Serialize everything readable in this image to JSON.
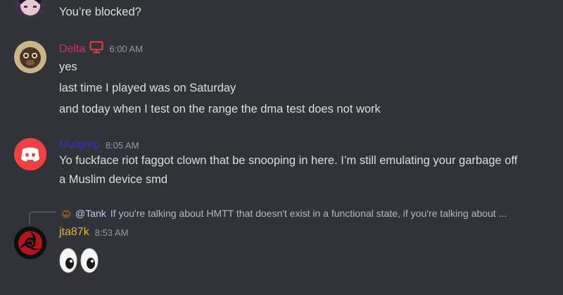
{
  "colors": {
    "background": "#313338",
    "text": "#dbdee1",
    "muted": "#949ba4",
    "delta_name": "#d62a6b",
    "mulgrep_name": "#3a2cc7",
    "jta_name": "#e9b421",
    "mention": "#c9cdfb",
    "discord_red": "#ed4245"
  },
  "messages": [
    {
      "lines": [
        "You’re blocked?"
      ]
    },
    {
      "author": "Delta",
      "badge_icon": "monitor-icon",
      "timestamp": "6:00 AM",
      "lines": [
        "yes",
        "last time I played was on Saturday",
        "and today when I test on the range the dma test does not work"
      ]
    },
    {
      "author": "Mulgrep",
      "timestamp": "8:05 AM",
      "lines": [
        "Yo fuckface riot faggot clown that be snooping in here. I’m still emulating your garbage off",
        "a Muslim device smd"
      ]
    },
    {
      "reply": {
        "mention": "@Tank",
        "text": "If you're talking about HMTT that doesn't exist in a functional state, if you're talking about ..."
      },
      "author": "jta87k",
      "timestamp": "8:53 AM",
      "emoji": "👀"
    }
  ]
}
